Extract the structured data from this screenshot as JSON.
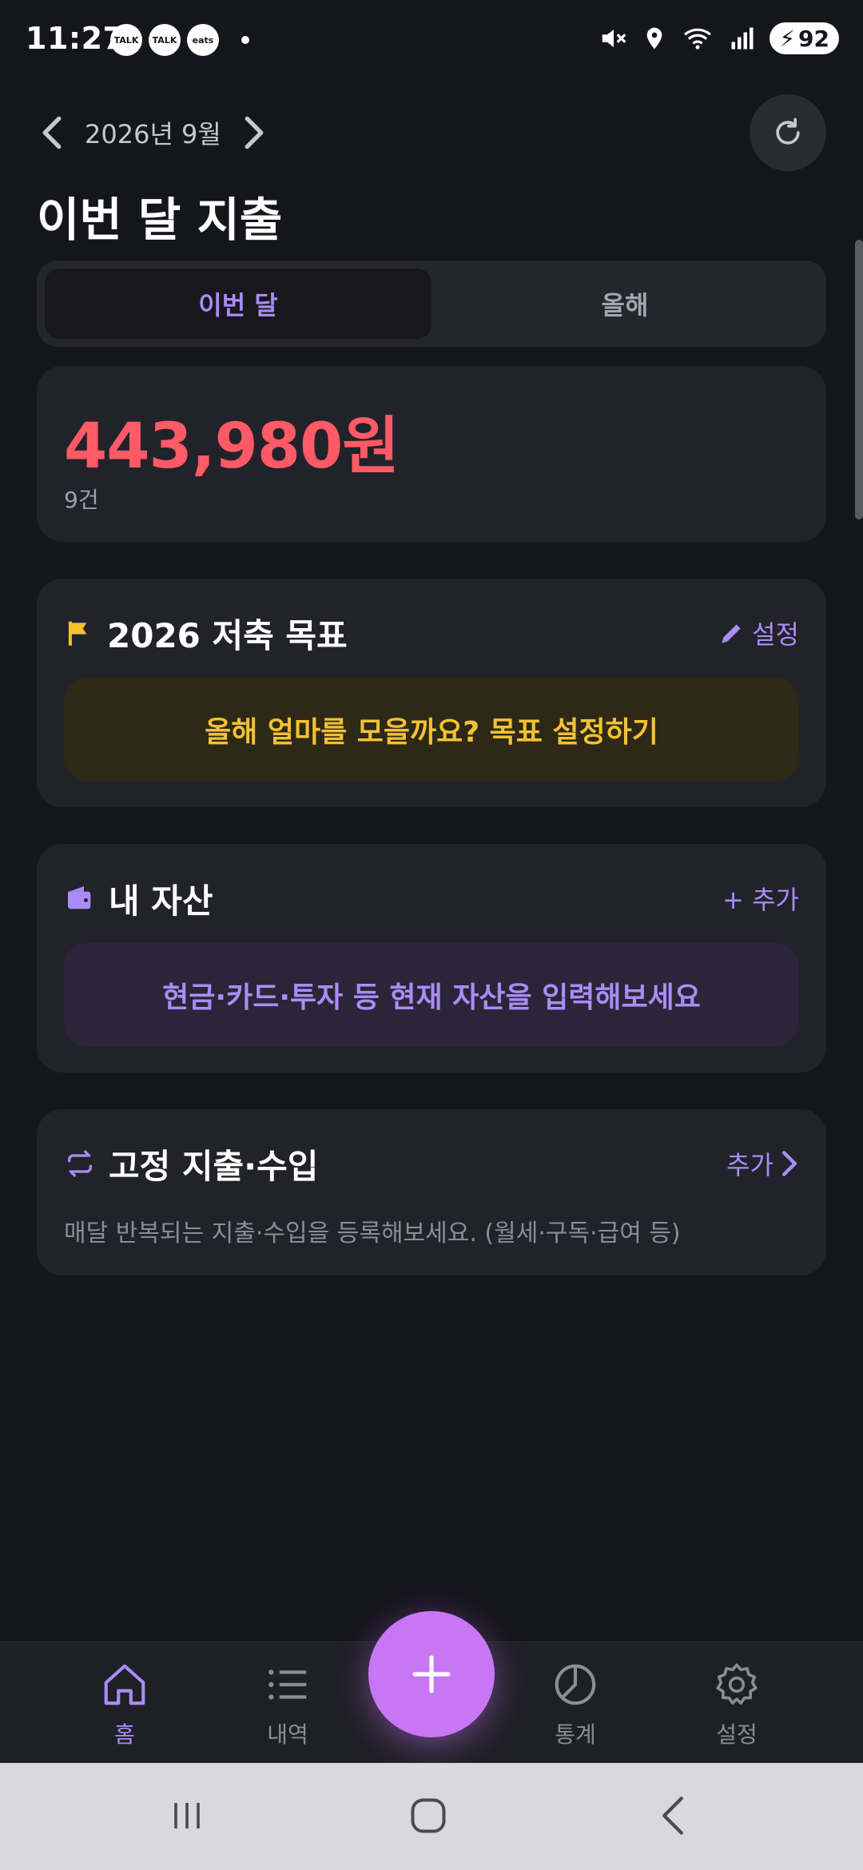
{
  "status_bar": {
    "time": "11:27",
    "left_badges": [
      "TALK",
      "TALK",
      "eats"
    ],
    "battery_level": "92"
  },
  "header": {
    "month": "2026년 9월",
    "title": "이번 달 지출"
  },
  "tabs": [
    {
      "label": "이번 달",
      "active": true
    },
    {
      "label": "올해",
      "active": false
    }
  ],
  "summary": {
    "amount": "443,980원",
    "count": "9건"
  },
  "goal_card": {
    "title": "2026 저축 목표",
    "action": "설정",
    "banner": "올해 얼마를 모을까요? 목표 설정하기"
  },
  "asset_card": {
    "title": "내 자산",
    "action": "+ 추가",
    "banner": "현금·카드·투자 등 현재 자산을 입력해보세요"
  },
  "fixed_card": {
    "title": "고정 지출·수입",
    "action": "추가",
    "description": "매달 반복되는 지출·수입을 등록해보세요. (월세·구독·급여 등)"
  },
  "bottom_nav": [
    {
      "label": "홈",
      "icon": "home-icon",
      "active": true
    },
    {
      "label": "내역",
      "icon": "list-icon",
      "active": false
    },
    {
      "label": "통계",
      "icon": "pie-chart-icon",
      "active": false
    },
    {
      "label": "설정",
      "icon": "gear-icon",
      "active": false
    }
  ],
  "colors": {
    "accent": "#a98cf5",
    "amount": "#ff5a65",
    "goal": "#f2c233",
    "fab": "#c976f5",
    "background": "#15151c"
  }
}
